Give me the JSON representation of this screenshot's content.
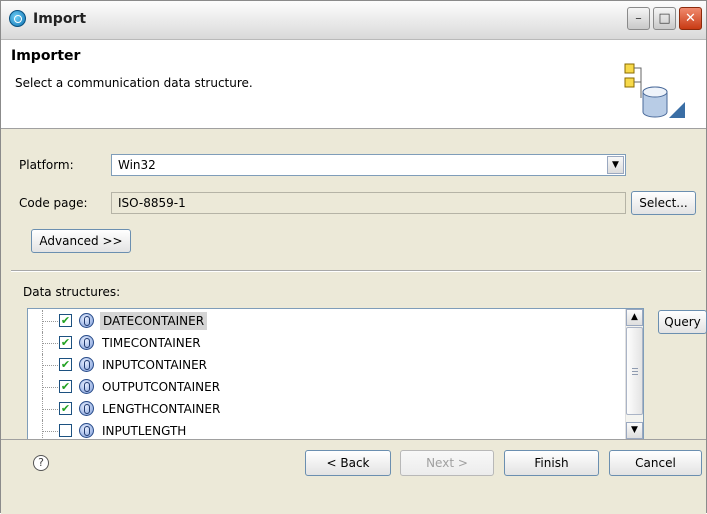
{
  "window": {
    "title": "Import",
    "icon": "import-app-icon",
    "controls": {
      "minimize": "–",
      "maximize": "□",
      "close": "✕"
    }
  },
  "header": {
    "title": "Importer",
    "subtitle": "Select a communication data structure.",
    "icon": "import-wizard-banner-icon"
  },
  "form": {
    "platform_label": "Platform:",
    "platform_value": "Win32",
    "codepage_label": "Code page:",
    "codepage_value": "ISO-8859-1",
    "select_button": "Select...",
    "advanced_button": "Advanced >>"
  },
  "data_structures": {
    "label": "Data structures:",
    "query_button": "Query",
    "items": [
      {
        "name": "DATECONTAINER",
        "checked": true,
        "selected": true,
        "checkmark": "✔"
      },
      {
        "name": "TIMECONTAINER",
        "checked": true,
        "selected": false,
        "checkmark": "✔"
      },
      {
        "name": "INPUTCONTAINER",
        "checked": true,
        "selected": false,
        "checkmark": "✔"
      },
      {
        "name": "OUTPUTCONTAINER",
        "checked": true,
        "selected": false,
        "checkmark": "✔"
      },
      {
        "name": "LENGTHCONTAINER",
        "checked": true,
        "selected": false,
        "checkmark": "✔"
      },
      {
        "name": "INPUTLENGTH",
        "checked": false,
        "selected": false,
        "checkmark": ""
      }
    ]
  },
  "footer": {
    "help": "?",
    "back_button": "< Back",
    "next_button": "Next >",
    "finish_button": "Finish",
    "cancel_button": "Cancel"
  },
  "colors": {
    "window_bg": "#ece9d8",
    "header_bg": "#ffffff",
    "selection_bg": "#d4d4d4",
    "checkmark": "#21a121"
  }
}
